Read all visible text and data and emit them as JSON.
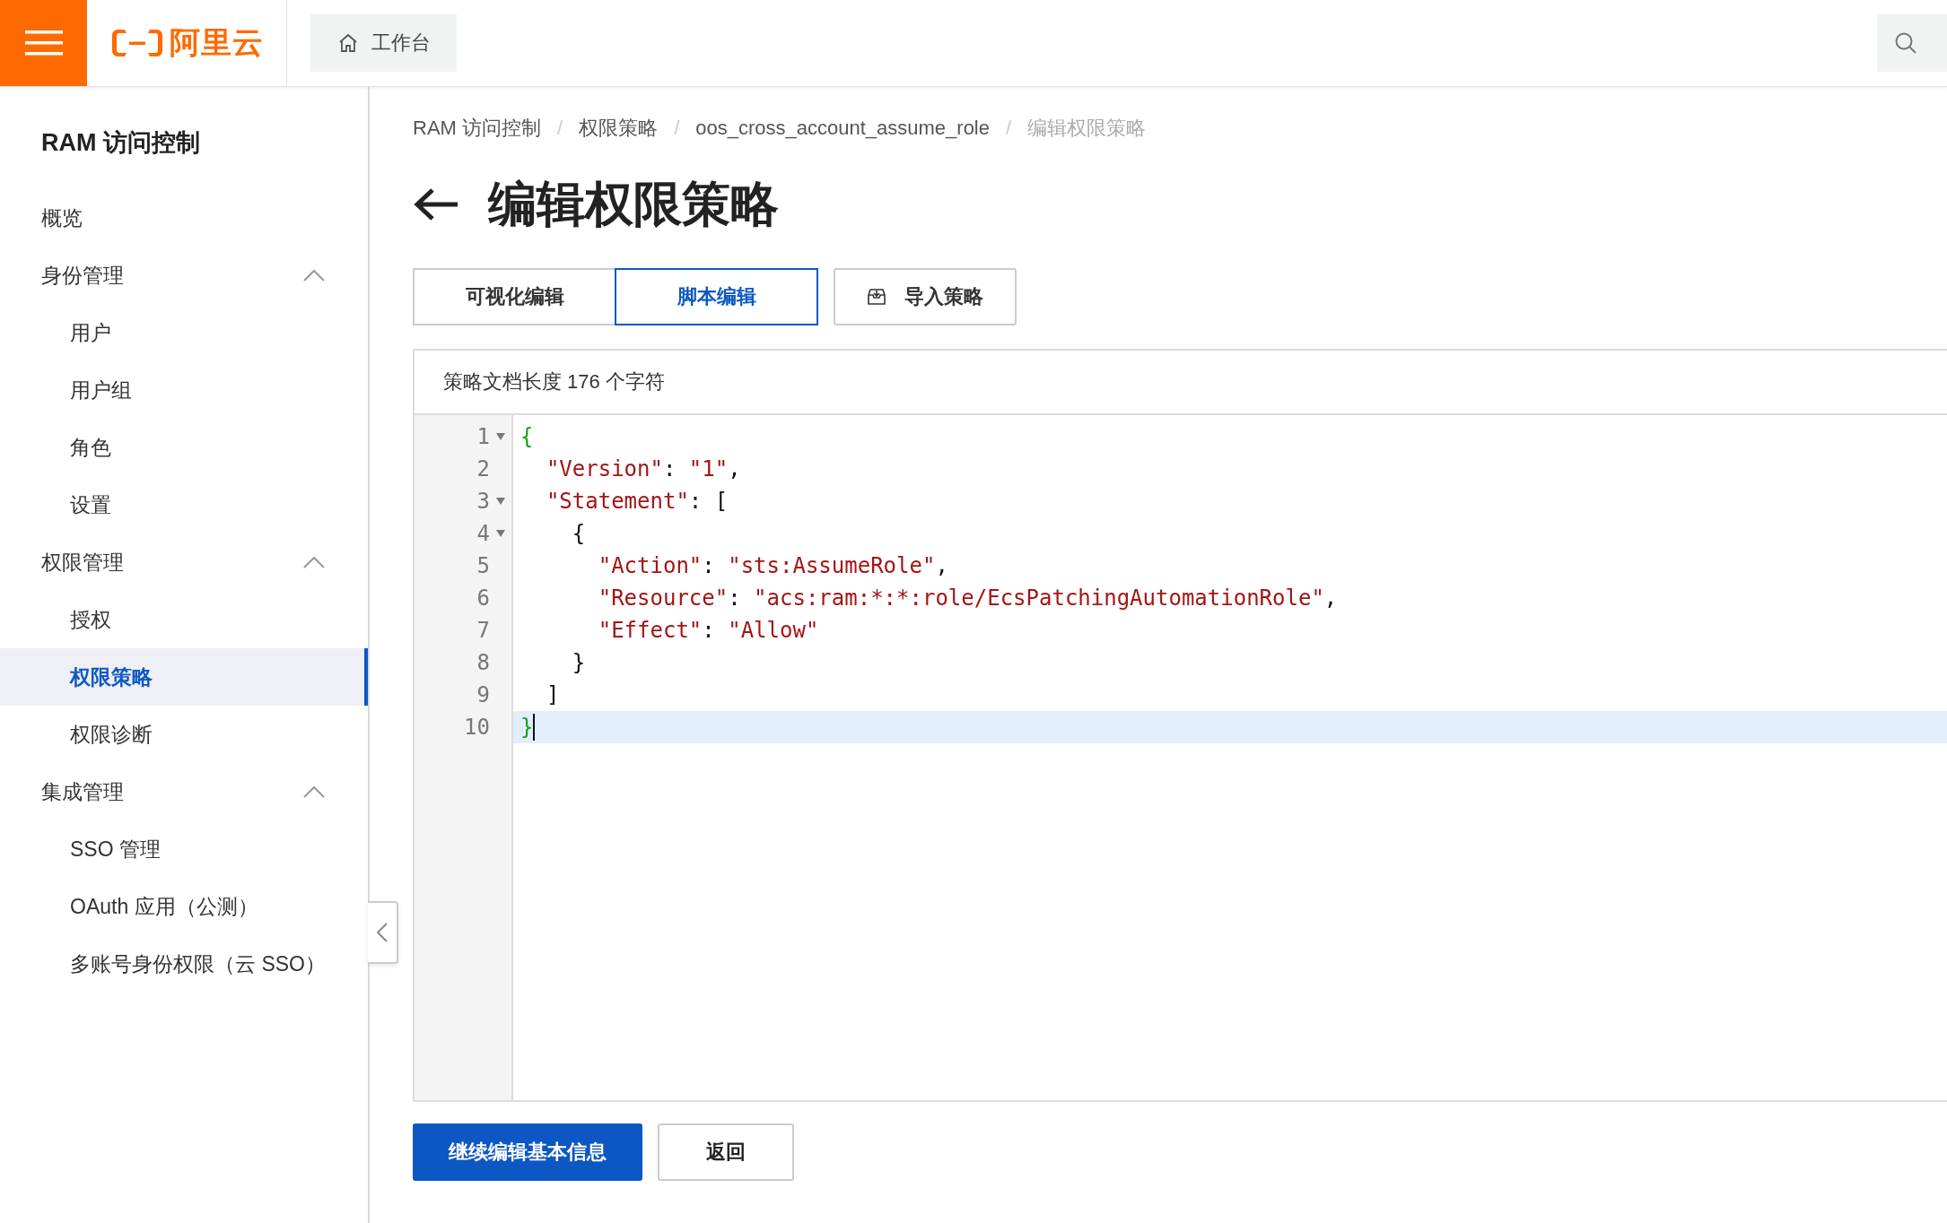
{
  "topbar": {
    "logo_text": "阿里云",
    "workbench": "工作台"
  },
  "sidebar": {
    "title": "RAM 访问控制",
    "items": [
      {
        "label": "概览",
        "selected": false
      },
      {
        "label": "身份管理",
        "expanded": true,
        "children": [
          {
            "label": "用户",
            "selected": false
          },
          {
            "label": "用户组",
            "selected": false
          },
          {
            "label": "角色",
            "selected": false
          },
          {
            "label": "设置",
            "selected": false
          }
        ]
      },
      {
        "label": "权限管理",
        "expanded": true,
        "children": [
          {
            "label": "授权",
            "selected": false
          },
          {
            "label": "权限策略",
            "selected": true
          },
          {
            "label": "权限诊断",
            "selected": false
          }
        ]
      },
      {
        "label": "集成管理",
        "expanded": true,
        "children": [
          {
            "label": "SSO 管理",
            "selected": false
          },
          {
            "label": "OAuth 应用（公测）",
            "selected": false
          },
          {
            "label": "多账号身份权限（云 SSO）",
            "selected": false
          }
        ]
      }
    ]
  },
  "breadcrumb": {
    "separator": "/",
    "items": [
      {
        "label": "RAM 访问控制",
        "current": false
      },
      {
        "label": "权限策略",
        "current": false
      },
      {
        "label": "oos_cross_account_assume_role",
        "current": false
      },
      {
        "label": "编辑权限策略",
        "current": true
      }
    ]
  },
  "page_title": "编辑权限策略",
  "tabs": [
    {
      "label": "可视化编辑",
      "selected": false
    },
    {
      "label": "脚本编辑",
      "selected": true
    }
  ],
  "import_button": "导入策略",
  "editor": {
    "length_note": "策略文档长度 176 个字符",
    "lines": [
      {
        "number": "1",
        "foldable": true,
        "active": false,
        "tokens": [
          {
            "kind": "brace",
            "text": "{"
          }
        ]
      },
      {
        "number": "2",
        "foldable": false,
        "active": false,
        "tokens": [
          {
            "kind": "string",
            "text": "  \"Version\""
          },
          {
            "kind": "punct",
            "text": ": "
          },
          {
            "kind": "string",
            "text": "\"1\""
          },
          {
            "kind": "punct",
            "text": ","
          }
        ]
      },
      {
        "number": "3",
        "foldable": true,
        "active": false,
        "tokens": [
          {
            "kind": "string",
            "text": "  \"Statement\""
          },
          {
            "kind": "punct",
            "text": ": ["
          }
        ]
      },
      {
        "number": "4",
        "foldable": true,
        "active": false,
        "tokens": [
          {
            "kind": "punct",
            "text": "    {"
          }
        ]
      },
      {
        "number": "5",
        "foldable": false,
        "active": false,
        "tokens": [
          {
            "kind": "string",
            "text": "      \"Action\""
          },
          {
            "kind": "punct",
            "text": ": "
          },
          {
            "kind": "string",
            "text": "\"sts:AssumeRole\""
          },
          {
            "kind": "punct",
            "text": ","
          }
        ]
      },
      {
        "number": "6",
        "foldable": false,
        "active": false,
        "tokens": [
          {
            "kind": "string",
            "text": "      \"Resource\""
          },
          {
            "kind": "punct",
            "text": ": "
          },
          {
            "kind": "string",
            "text": "\"acs:ram:*:*:role/EcsPatchingAutomationRole\""
          },
          {
            "kind": "punct",
            "text": ","
          }
        ]
      },
      {
        "number": "7",
        "foldable": false,
        "active": false,
        "tokens": [
          {
            "kind": "string",
            "text": "      \"Effect\""
          },
          {
            "kind": "punct",
            "text": ": "
          },
          {
            "kind": "string",
            "text": "\"Allow\""
          }
        ]
      },
      {
        "number": "8",
        "foldable": false,
        "active": false,
        "tokens": [
          {
            "kind": "punct",
            "text": "    }"
          }
        ]
      },
      {
        "number": "9",
        "foldable": false,
        "active": false,
        "tokens": [
          {
            "kind": "punct",
            "text": "  ]"
          }
        ]
      },
      {
        "number": "10",
        "foldable": false,
        "active": true,
        "tokens": [
          {
            "kind": "brace",
            "text": "}"
          }
        ]
      }
    ]
  },
  "actions": [
    {
      "label": "继续编辑基本信息",
      "kind": "primary"
    },
    {
      "label": "返回",
      "kind": "secondary"
    }
  ]
}
